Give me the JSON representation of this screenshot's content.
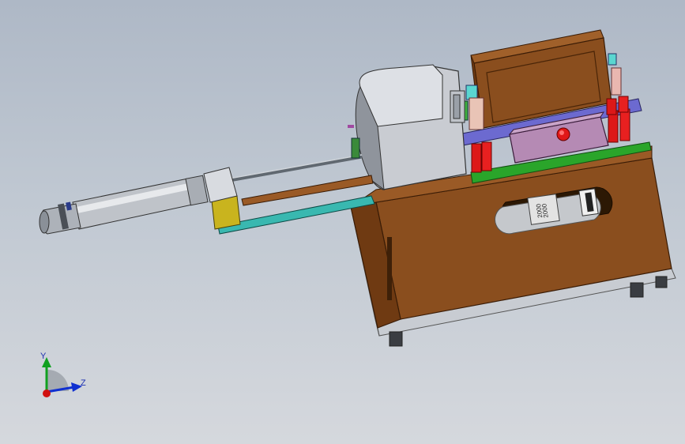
{
  "viewport": {
    "background_top": "#aeb8c6",
    "background_bottom": "#d5d8dd"
  },
  "model": {
    "motor_label_line1": "2000",
    "motor_label_line2": "2000"
  },
  "triad": {
    "y_label": "Y",
    "z_label": "Z",
    "colors": {
      "x": "#d01010",
      "y": "#10a020",
      "z": "#1030d0"
    }
  }
}
